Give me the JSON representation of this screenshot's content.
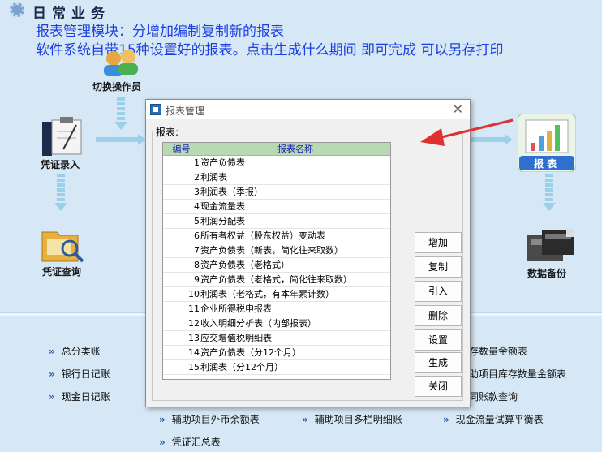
{
  "header": {
    "title": "日常业务"
  },
  "notes": {
    "line1": "报表管理模块：分增加编制复制新的报表",
    "line2": "软件系统自带15种设置好的报表。点击生成什么期间 即可完成 可以另存打印"
  },
  "icons": {
    "switch_operator": "切换操作员",
    "voucher_entry": "凭证录入",
    "voucher_query": "凭证查询",
    "reports": "报 表",
    "data_backup": "数据备份"
  },
  "bottom_links": {
    "left": [
      "总分类账",
      "银行日记账",
      "现金日记账"
    ],
    "right_partial": [
      "存数量金额表",
      "助项目库存数量金额表",
      "同账款查询"
    ],
    "row4": [
      "辅助项目外币余额表",
      "辅助项目多栏明细账",
      "现金流量试算平衡表"
    ],
    "row5": "凭证汇总表"
  },
  "dialog": {
    "title": "报表管理",
    "group_label": "报表:",
    "columns": [
      "编号",
      "报表名称"
    ],
    "rows": [
      {
        "num": "1",
        "name": "资产负债表"
      },
      {
        "num": "2",
        "name": "利润表"
      },
      {
        "num": "3",
        "name": "利润表（季报）"
      },
      {
        "num": "4",
        "name": "现金流量表"
      },
      {
        "num": "5",
        "name": "利润分配表"
      },
      {
        "num": "6",
        "name": "所有者权益（股东权益）变动表"
      },
      {
        "num": "7",
        "name": "资产负债表（新表，简化往来取数）"
      },
      {
        "num": "8",
        "name": "资产负债表（老格式）"
      },
      {
        "num": "9",
        "name": "资产负债表（老格式，简化往来取数）"
      },
      {
        "num": "10",
        "name": "利润表（老格式，有本年累计数）"
      },
      {
        "num": "11",
        "name": "企业所得税申报表"
      },
      {
        "num": "12",
        "name": "收入明细分析表（内部报表）"
      },
      {
        "num": "13",
        "name": "应交增值税明细表"
      },
      {
        "num": "14",
        "name": "资产负债表（分12个月）"
      },
      {
        "num": "15",
        "name": "利润表（分12个月）"
      }
    ],
    "buttons": {
      "add": "增加",
      "copy": "复制",
      "import": "引入",
      "delete": "删除",
      "settings": "设置",
      "generate": "生成",
      "close": "关闭"
    }
  },
  "colors": {
    "note_blue": "#1c3fe0",
    "arrow_red": "#e03030",
    "background": "#d6e8f6"
  }
}
